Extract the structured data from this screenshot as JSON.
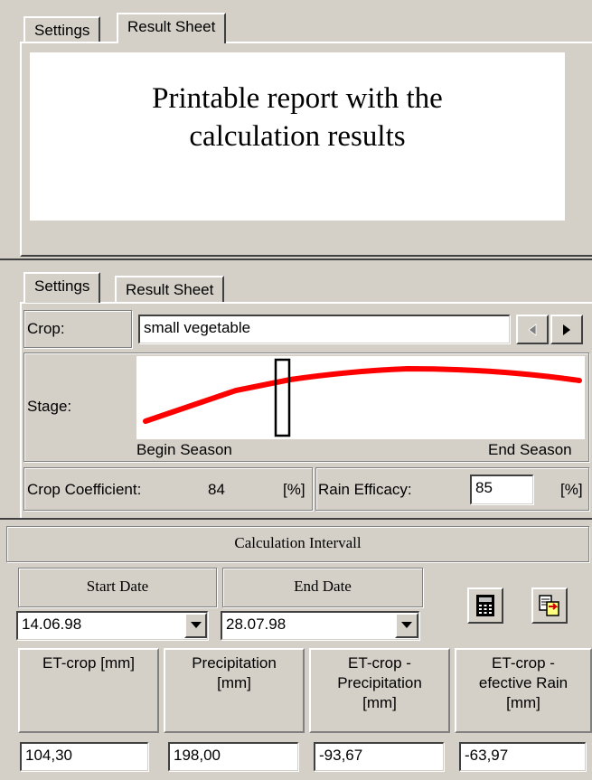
{
  "top_tabs": [
    "Settings",
    "Result Sheet"
  ],
  "report_text": [
    "Printable report with the",
    "calculation results"
  ],
  "settings_tabs": [
    "Settings",
    "Result Sheet"
  ],
  "crop": {
    "label": "Crop:",
    "value": "small vegetable"
  },
  "stage": {
    "label": "Stage:",
    "begin_label": "Begin Season",
    "end_label": "End Season"
  },
  "coefficient": {
    "label": "Crop Coefficient:",
    "value": "84",
    "unit": "[%]"
  },
  "rain_efficacy": {
    "label": "Rain Efficacy:",
    "value": "85",
    "unit": "[%]"
  },
  "interval": {
    "title": "Calculation Intervall",
    "start_label": "Start Date",
    "start_value": "14.06.98",
    "end_label": "End Date",
    "end_value": "28.07.98"
  },
  "results": {
    "headers": [
      [
        "ET-crop [mm]"
      ],
      [
        "Precipitation",
        "[mm]"
      ],
      [
        "ET-crop -",
        "Precipitation",
        "[mm]"
      ],
      [
        "ET-crop -",
        "efective Rain",
        "[mm]"
      ]
    ],
    "values": [
      "104,30",
      "198,00",
      "-93,67",
      "-63,97"
    ]
  },
  "colors": {
    "curve": "#ff0000",
    "window_bg": "#d4d0c8"
  },
  "icons": [
    "calculator-icon",
    "report-icon",
    "arrow-left-icon",
    "arrow-right-icon",
    "dropdown-arrow-icon"
  ]
}
